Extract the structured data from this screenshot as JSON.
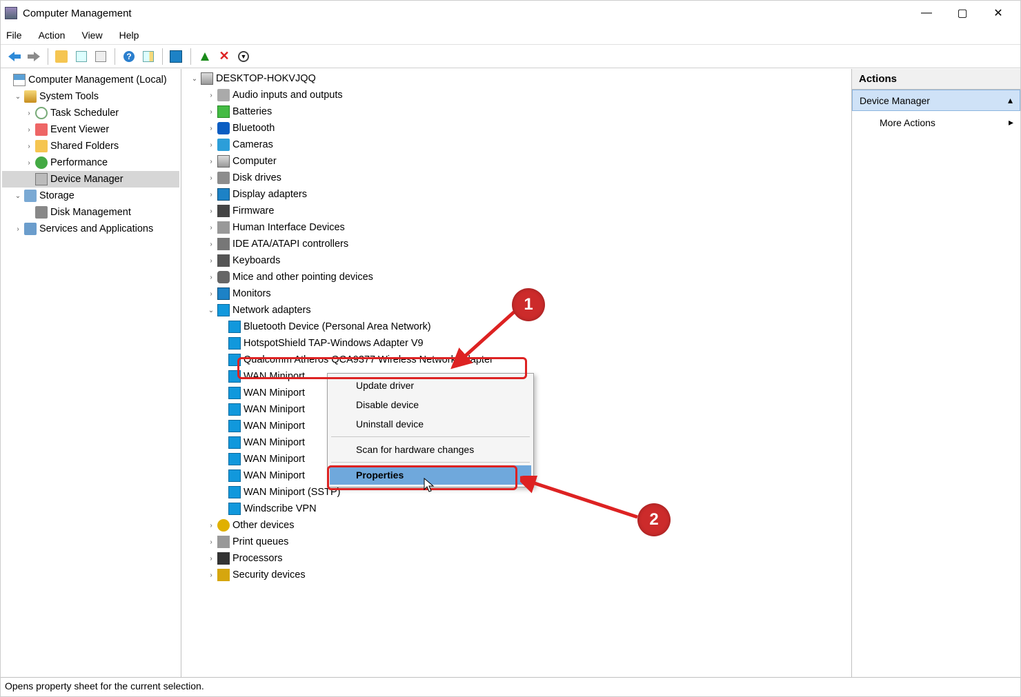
{
  "window": {
    "title": "Computer Management"
  },
  "menu": {
    "file": "File",
    "action": "Action",
    "view": "View",
    "help": "Help"
  },
  "left_tree": {
    "root": "Computer Management (Local)",
    "system_tools": "System Tools",
    "task_scheduler": "Task Scheduler",
    "event_viewer": "Event Viewer",
    "shared_folders": "Shared Folders",
    "performance": "Performance",
    "device_manager": "Device Manager",
    "storage": "Storage",
    "disk_management": "Disk Management",
    "services": "Services and Applications"
  },
  "device_tree": {
    "computer": "DESKTOP-HOKVJQQ",
    "audio": "Audio inputs and outputs",
    "batteries": "Batteries",
    "bluetooth": "Bluetooth",
    "cameras": "Cameras",
    "computer_cat": "Computer",
    "disk_drives": "Disk drives",
    "display": "Display adapters",
    "firmware": "Firmware",
    "hid": "Human Interface Devices",
    "ide": "IDE ATA/ATAPI controllers",
    "keyboards": "Keyboards",
    "mice": "Mice and other pointing devices",
    "monitors": "Monitors",
    "network": "Network adapters",
    "net_items": {
      "bt_pan": "Bluetooth Device (Personal Area Network)",
      "hotspot": "HotspotShield TAP-Windows Adapter V9",
      "qca": "Qualcomm Atheros QCA9377 Wireless Network Adapter",
      "wan0": "WAN Miniport",
      "wan1": "WAN Miniport",
      "wan2": "WAN Miniport",
      "wan3": "WAN Miniport",
      "wan4": "WAN Miniport",
      "wan5": "WAN Miniport",
      "wan6": "WAN Miniport",
      "wan_sstp": "WAN Miniport (SSTP)",
      "windscribe": "Windscribe VPN"
    },
    "other": "Other devices",
    "print": "Print queues",
    "processors": "Processors",
    "security": "Security devices"
  },
  "context_menu": {
    "update": "Update driver",
    "disable": "Disable device",
    "uninstall": "Uninstall device",
    "scan": "Scan for hardware changes",
    "properties": "Properties"
  },
  "actions": {
    "header": "Actions",
    "selected": "Device Manager",
    "more": "More Actions"
  },
  "annotations": {
    "one": "1",
    "two": "2"
  },
  "status": "Opens property sheet for the current selection."
}
